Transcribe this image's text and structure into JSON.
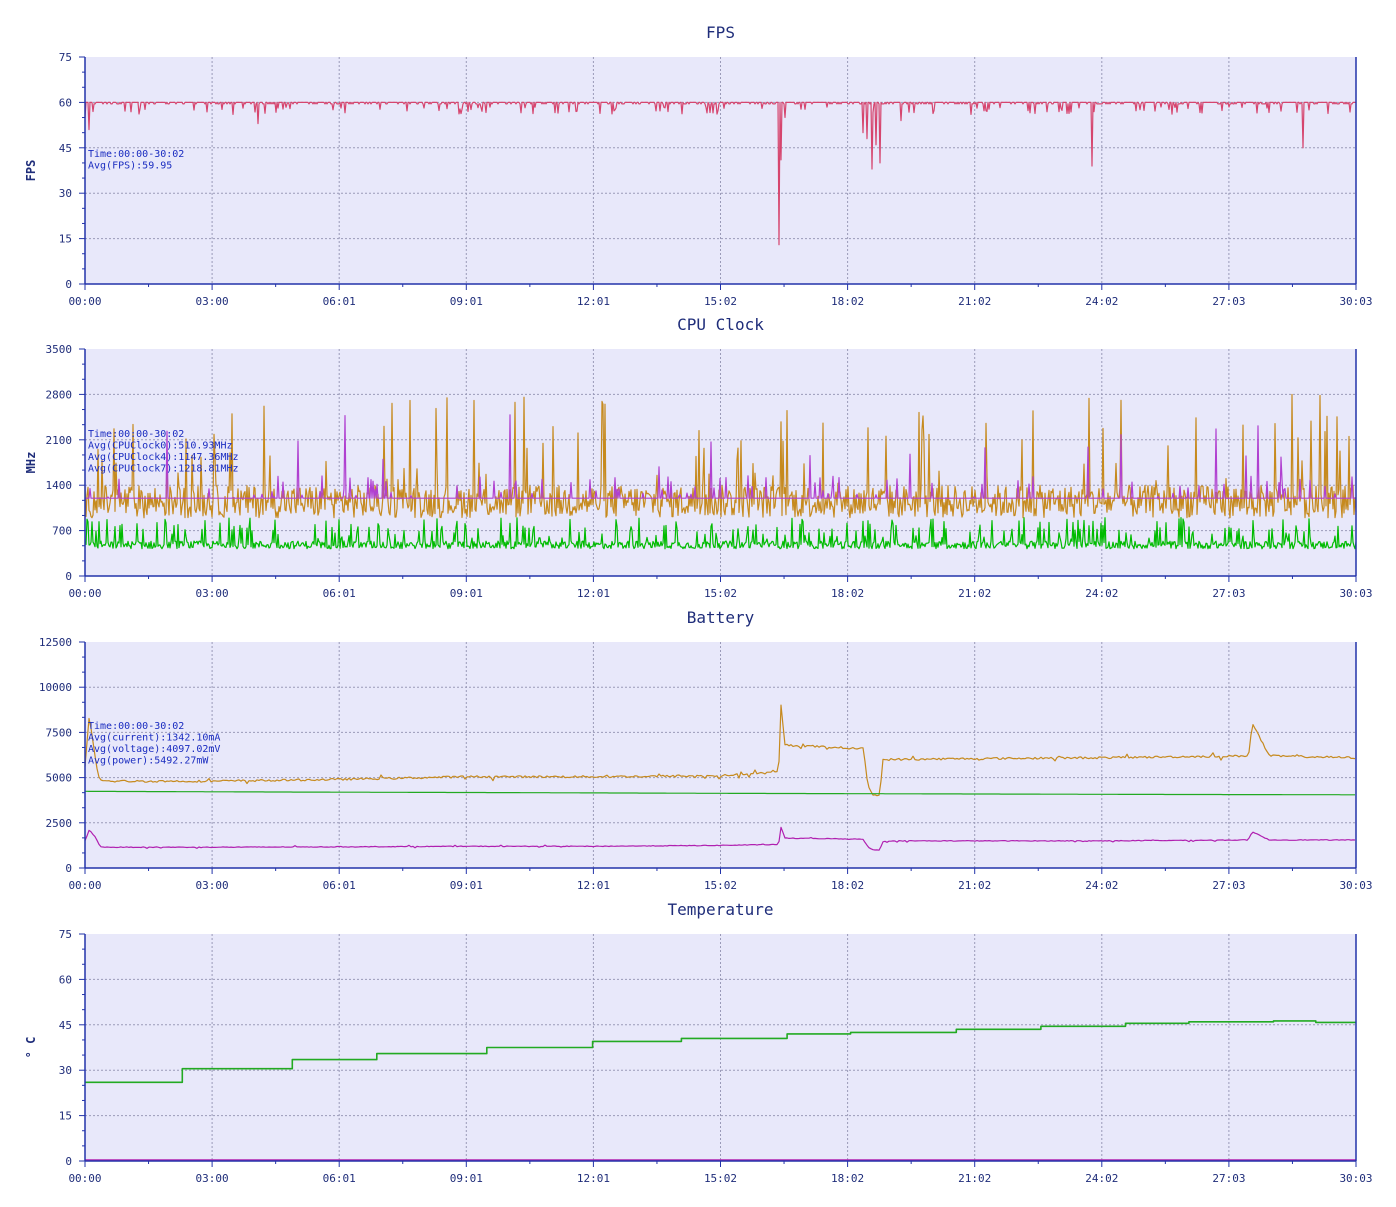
{
  "chart_data": [
    {
      "type": "line",
      "title": "FPS",
      "ylabel": "FPS",
      "ylim": [
        0,
        75
      ],
      "yticks": [
        "0",
        "15",
        "30",
        "45",
        "60",
        "75"
      ],
      "xticks": [
        "00:00",
        "03:00",
        "06:01",
        "09:01",
        "12:01",
        "15:02",
        "18:02",
        "21:02",
        "24:02",
        "27:03",
        "30:03"
      ],
      "xlim_minutes": [
        0,
        30.05
      ],
      "annotations": [
        "Time:00:00-30:02",
        "Avg(FPS):59.95"
      ],
      "series": [
        {
          "color": "#d6456e",
          "base": 60,
          "x": [
            0.0,
            0.1,
            0.2,
            4.1,
            16.4,
            16.45,
            16.55,
            18.4,
            18.5,
            18.6,
            18.7,
            18.8,
            19.3,
            23.8,
            28.8
          ],
          "y": [
            55,
            51,
            57,
            53,
            13,
            41,
            55,
            50,
            48,
            38,
            46,
            40,
            54,
            39,
            45
          ]
        }
      ]
    },
    {
      "type": "line",
      "title": "CPU Clock",
      "ylabel": "MHz",
      "ylim": [
        0,
        3500
      ],
      "yticks": [
        "0",
        "700",
        "1400",
        "2100",
        "2800",
        "3500"
      ],
      "xticks": [
        "00:00",
        "03:00",
        "06:01",
        "09:01",
        "12:01",
        "15:02",
        "18:02",
        "21:02",
        "24:02",
        "27:03",
        "30:03"
      ],
      "xlim_minutes": [
        0,
        30.05
      ],
      "annotations": [
        "Time:00:00-30:02",
        "Avg(CPUClock0):510.93MHz",
        "Avg(CPUClock4):1147.36MHz",
        "Avg(CPUClock7):1218.81MHz"
      ],
      "series": [
        {
          "color": "#00bb00",
          "mean": 510.93,
          "low": 420,
          "high": 900
        },
        {
          "color": "#c68a1e",
          "mean": 1147.36,
          "low": 750,
          "high": 2800
        },
        {
          "color": "#b040d0",
          "mean": 1218.81,
          "low": 1200,
          "high": 2500
        }
      ]
    },
    {
      "type": "line",
      "title": "Battery",
      "ylabel": "",
      "ylim": [
        0,
        12500
      ],
      "yticks": [
        "0",
        "2500",
        "5000",
        "7500",
        "10000",
        "12500"
      ],
      "xticks": [
        "00:00",
        "03:00",
        "06:01",
        "09:01",
        "12:01",
        "15:02",
        "18:02",
        "21:02",
        "24:02",
        "27:03",
        "30:03"
      ],
      "xlim_minutes": [
        0,
        30.05
      ],
      "annotations": [
        "Time:00:00-30:02",
        "Avg(current):1342.10mA",
        "Avg(voltage):4097.02mV",
        "Avg(power):5492.27mW"
      ],
      "series": [
        {
          "color": "#c68a1e",
          "x": [
            0,
            0.1,
            0.25,
            0.35,
            0.5,
            3.0,
            6.0,
            9.0,
            12.0,
            15.0,
            16.4,
            16.45,
            16.55,
            18.4,
            18.5,
            18.6,
            18.8,
            18.85,
            19.0,
            21.0,
            24.0,
            27.5,
            27.6,
            28.0,
            30.05
          ],
          "y": [
            5600,
            8400,
            6000,
            4850,
            4800,
            4800,
            4900,
            5050,
            5050,
            5100,
            5300,
            9100,
            6800,
            6600,
            4700,
            4100,
            4000,
            6000,
            6000,
            6050,
            6100,
            6200,
            8000,
            6200,
            6100
          ]
        },
        {
          "color": "#22aa22",
          "x": [
            0,
            5,
            10,
            15,
            20,
            25,
            30.05
          ],
          "y": [
            4240,
            4200,
            4170,
            4130,
            4100,
            4070,
            4050
          ]
        },
        {
          "color": "#b020b0",
          "x": [
            0,
            0.1,
            0.25,
            0.35,
            0.5,
            3.0,
            6.0,
            9.0,
            12.0,
            15.0,
            16.4,
            16.45,
            16.55,
            18.4,
            18.5,
            18.6,
            18.8,
            18.85,
            19.0,
            21.0,
            24.0,
            27.5,
            27.6,
            28.0,
            30.05
          ],
          "y": [
            1500,
            2100,
            1700,
            1200,
            1150,
            1150,
            1170,
            1200,
            1200,
            1250,
            1300,
            2300,
            1650,
            1600,
            1200,
            1000,
            1000,
            1450,
            1500,
            1500,
            1500,
            1550,
            2000,
            1550,
            1550
          ]
        }
      ]
    },
    {
      "type": "line",
      "title": "Temperature",
      "ylabel": "° C",
      "ylim": [
        0,
        75
      ],
      "yticks": [
        "0",
        "15",
        "30",
        "45",
        "60",
        "75"
      ],
      "xticks": [
        "00:00",
        "03:00",
        "06:01",
        "09:01",
        "12:01",
        "15:02",
        "18:02",
        "21:02",
        "24:02",
        "27:03",
        "30:03"
      ],
      "xlim_minutes": [
        0,
        30.05
      ],
      "annotations": [],
      "series": [
        {
          "color": "#22aa22",
          "x": [
            0,
            2.3,
            2.3,
            4.9,
            4.9,
            6.9,
            6.9,
            9.5,
            9.5,
            12.0,
            12.0,
            14.1,
            14.1,
            16.6,
            16.6,
            18.1,
            18.1,
            20.6,
            20.6,
            22.6,
            22.6,
            24.6,
            24.6,
            26.1,
            26.1,
            28.1,
            28.1,
            29.1,
            29.1,
            30.05
          ],
          "y": [
            26,
            26,
            30.5,
            30.5,
            33.5,
            33.5,
            35.5,
            35.5,
            37.5,
            37.5,
            39.5,
            39.5,
            40.5,
            40.5,
            42,
            42,
            42.5,
            42.5,
            43.5,
            43.5,
            44.5,
            44.5,
            45.5,
            45.5,
            46,
            46,
            46.3,
            46.3,
            45.8,
            45.8
          ]
        },
        {
          "color": "#b020b0",
          "x": [
            0,
            30.05
          ],
          "y": [
            0.3,
            0.3
          ]
        }
      ]
    }
  ]
}
